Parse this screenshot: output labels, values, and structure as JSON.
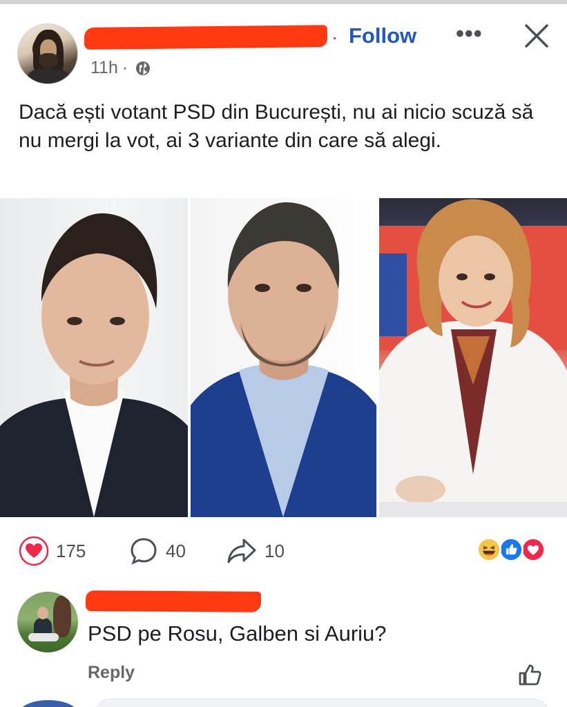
{
  "post": {
    "author_redacted": true,
    "follow_label": "Follow",
    "more_icon": "more-horizontal-icon",
    "close_icon": "close-icon",
    "time": "11h",
    "separator": "·",
    "privacy_icon": "globe-icon",
    "text": "Dacă ești votant PSD din București, nu ai nicio scuză să nu mergi la vot, ai 3 variante din care să alegi."
  },
  "images": [
    {
      "label": "photo-1"
    },
    {
      "label": "photo-2"
    },
    {
      "label": "photo-3"
    }
  ],
  "stats": {
    "reactions": "175",
    "comments": "40",
    "shares": "10",
    "reaction_icons": [
      "haha-icon",
      "like-icon",
      "love-icon"
    ]
  },
  "comment": {
    "author_redacted": true,
    "text": "PSD pe Rosu, Galben si Auriu?",
    "reply_label": "Reply",
    "like_icon": "thumbs-up-icon"
  },
  "colors": {
    "accent": "#1f57c5",
    "redaction": "#ff3a12",
    "heart": "#f0284a",
    "secondary_text": "#65676b"
  }
}
